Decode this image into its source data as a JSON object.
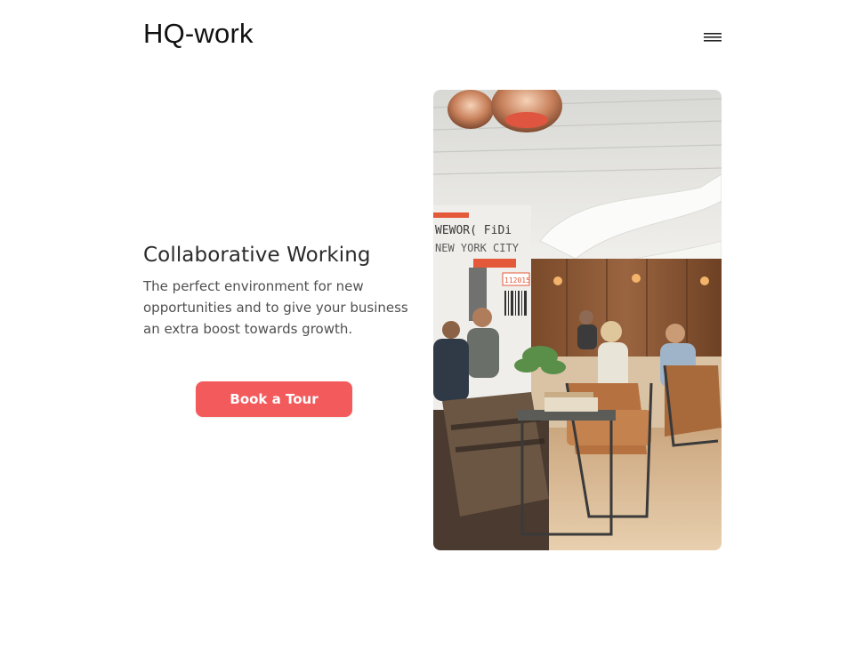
{
  "header": {
    "logo_text": "HQ-work",
    "menu_icon": "hamburger-menu-icon"
  },
  "hero": {
    "title": "Collaborative Working",
    "description": "The perfect environment for new opportunities and to give your business an extra boost towards growth.",
    "cta_label": "Book a Tour",
    "cta_color": "#f25a5c"
  },
  "photo": {
    "wall_sign_line1": "WEWOR( FiDi",
    "wall_sign_line2": "NEW YORK CITY",
    "wall_sign_number": "112015"
  }
}
